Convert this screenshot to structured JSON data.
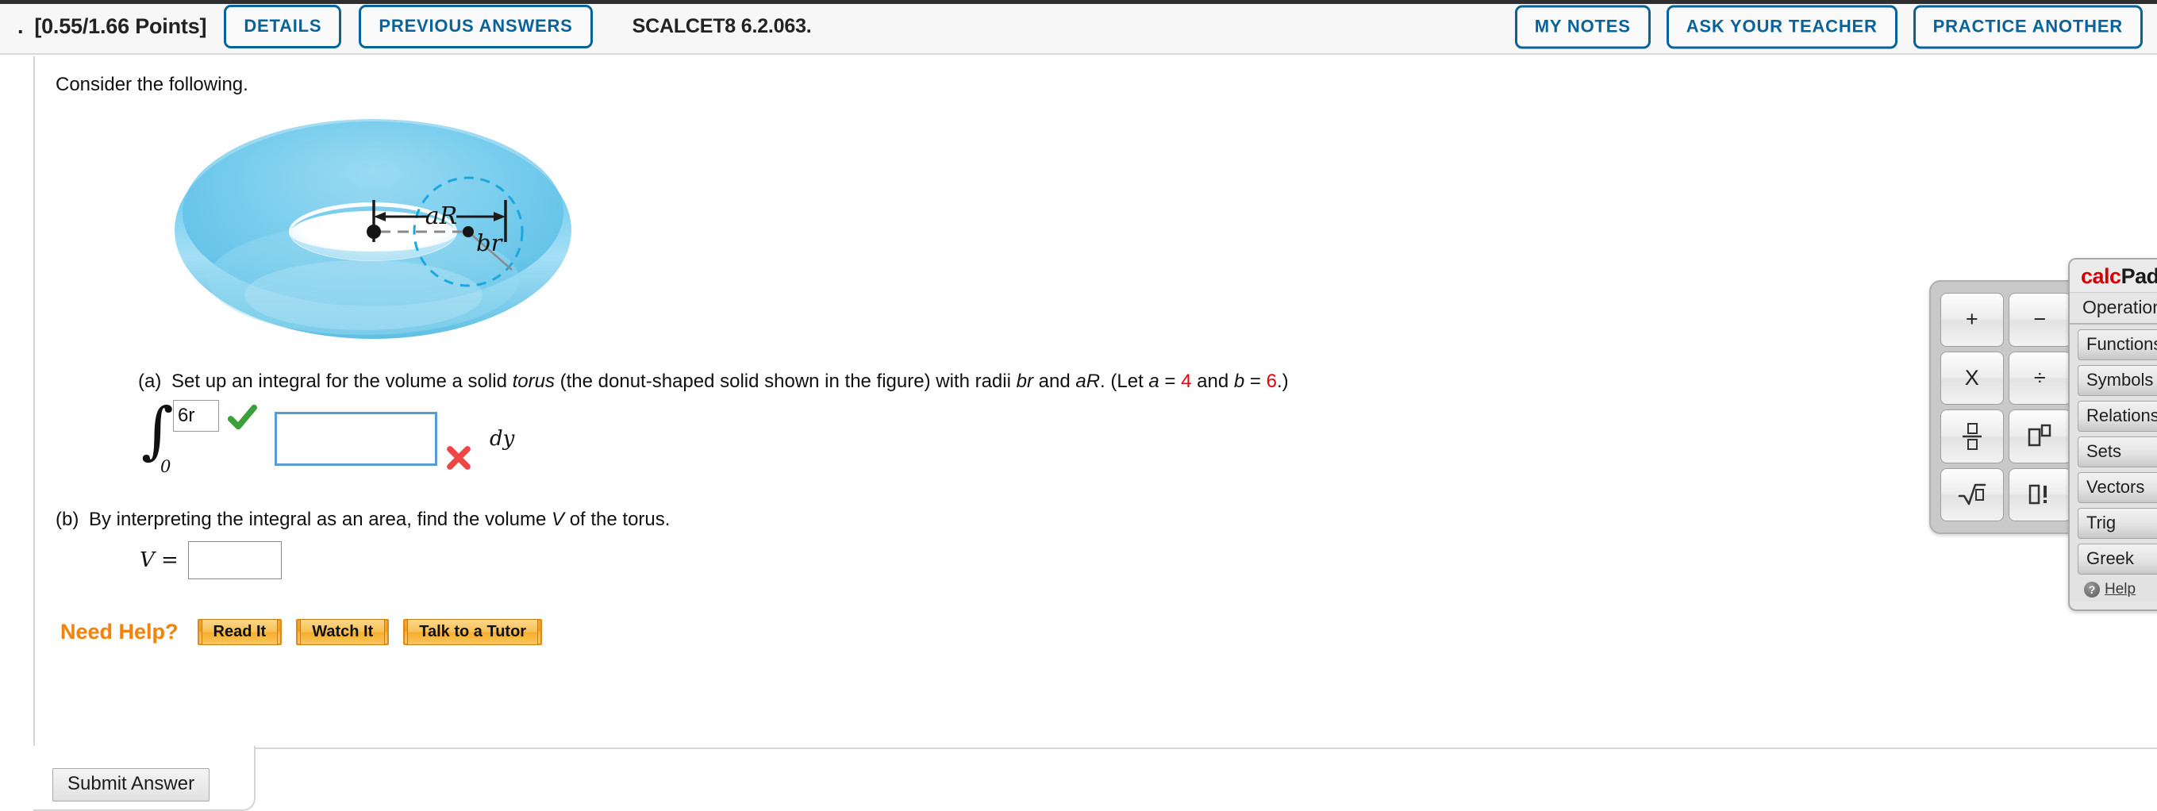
{
  "header": {
    "question_number_prefix": ".",
    "points": "[0.55/1.66 Points]",
    "details_label": "DETAILS",
    "previous_answers_label": "PREVIOUS ANSWERS",
    "module_code": "SCALCET8 6.2.063.",
    "my_notes_label": "MY NOTES",
    "ask_teacher_label": "ASK YOUR TEACHER",
    "practice_another_label": "PRACTICE ANOTHER",
    "accent_color": "#09639a"
  },
  "body": {
    "intro": "Consider the following.",
    "figure": {
      "name": "torus-diagram",
      "outer_label": "aR",
      "inner_label": "br",
      "fill_color": "#5ec3e8",
      "dashed_circle_color": "#1aa7e0"
    },
    "part_a": {
      "label": "(a)",
      "text_1": "Set up an integral for the volume a solid ",
      "torus_word": "torus",
      "text_2": " (the donut-shaped solid shown in the figure) with radii ",
      "radius_1": "br",
      "text_3": " and ",
      "radius_2": "aR",
      "text_4": ". (Let ",
      "var_a": "a",
      "eq1": " = ",
      "val_a": "4",
      "text_5": " and ",
      "var_b": "b",
      "eq2": " = ",
      "val_b": "6",
      "text_6": ".)",
      "integral_lower_limit": "0",
      "integral_upper_value": "6r",
      "integral_upper_status": "correct",
      "integrand_value": "",
      "integrand_placeholder": "",
      "integrand_status": "incorrect",
      "differential": "dy"
    },
    "part_b": {
      "label": "(b)",
      "text_1": "By interpreting the integral as an area, find the volume ",
      "var_v": "V",
      "text_2": " of the torus.",
      "v_equals": "V =",
      "v_value": ""
    },
    "need_help": {
      "label": "Need Help?",
      "buttons": [
        {
          "name": "read-it",
          "label": "Read It"
        },
        {
          "name": "watch-it",
          "label": "Watch It"
        },
        {
          "name": "talk-to-a-tutor",
          "label": "Talk to a Tutor"
        }
      ],
      "color": "#f0840f"
    },
    "submit_label": "Submit Answer"
  },
  "calcpad": {
    "title_calc": "calc",
    "title_pad": "Pad",
    "subheader": "Operations",
    "categories": [
      "Functions",
      "Symbols",
      "Relations",
      "Sets",
      "Vectors",
      "Trig",
      "Greek"
    ],
    "help_label": "Help",
    "help_icon_glyph": "?",
    "operation_keys": [
      {
        "name": "plus-key",
        "glyph": "+"
      },
      {
        "name": "minus-key",
        "glyph": "−"
      },
      {
        "name": "multiply-key",
        "glyph": "X"
      },
      {
        "name": "divide-key",
        "glyph": "÷"
      },
      {
        "name": "fraction-key",
        "glyph": ""
      },
      {
        "name": "exponent-key",
        "glyph": ""
      },
      {
        "name": "sqrt-key",
        "glyph": ""
      },
      {
        "name": "factorial-key",
        "glyph": ""
      }
    ]
  }
}
